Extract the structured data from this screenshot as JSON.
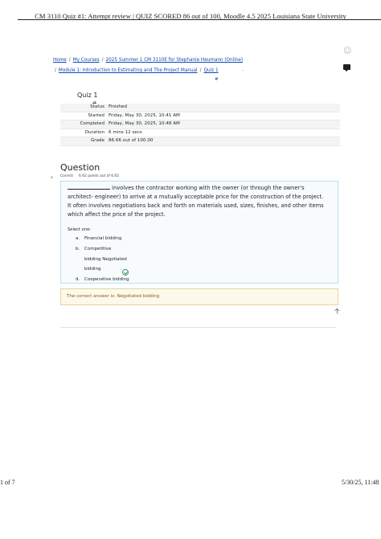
{
  "print_header": "CM 3110 Quiz #1: Attempt review | QUIZ SCORED 86 out of 100, Moodle 4.5 2025 Louisiana State University",
  "breadcrumb": {
    "home": "Home",
    "my_courses": "My Courses",
    "course": "2025 Summer 1 CM 3110E for Stephanie Heumann (Online)",
    "module": "Module 1: Introduction to Estimating and The Project Manual",
    "quiz": "Quiz 1",
    "quiz_hash": "#",
    "separator": "/"
  },
  "quiz_title": "Quiz 1",
  "quiz_hash": "#",
  "summary": [
    {
      "label": "Status",
      "value": "Finished"
    },
    {
      "label": "Started",
      "value": "Friday, May 30, 2025, 10:41 AM"
    },
    {
      "label": "Completed",
      "value": "Friday, May 30, 2025, 10:48 AM"
    },
    {
      "label": "Duration",
      "value": "6 mins 12 secs"
    },
    {
      "label": "Grade",
      "value": "86.66 out of 100.00"
    }
  ],
  "question": {
    "heading": "Question",
    "status": "Correct",
    "points": "6.62 points out of 6.62",
    "text_after_blank": " involves the contractor working with the owner (or through the owner's architect- engineer) to arrive at a mutually acceptable price for the construction of the project. It often involves negotiations back and forth on materials used, sizes, finishes, and other items which affect the price of the project.",
    "select_one": "Select one:",
    "options": {
      "a_letter": "a.",
      "a_text": "Financial bidding",
      "b_letter": "b.",
      "b_text_line1": "Competitive",
      "b_text_line2": "bidding Negotiated",
      "b_text_line3": "bidding",
      "d_letter": "d.",
      "d_text": "Cooperative bidding"
    },
    "feedback": "The correct answer is: Negotiated bidding"
  },
  "footer": {
    "page": "1 of 7",
    "datetime": "5/30/25, 11:48"
  },
  "icons": {
    "user": "user-icon",
    "messages": "message-icon",
    "back": "chevron-left-icon",
    "top": "arrow-up-icon",
    "correct": "check-circle-icon"
  },
  "colors": {
    "link": "#0f47ad",
    "question_border": "#b9e0ea",
    "feedback_bg": "#fdf9ea",
    "correct": "#3a9b62"
  }
}
